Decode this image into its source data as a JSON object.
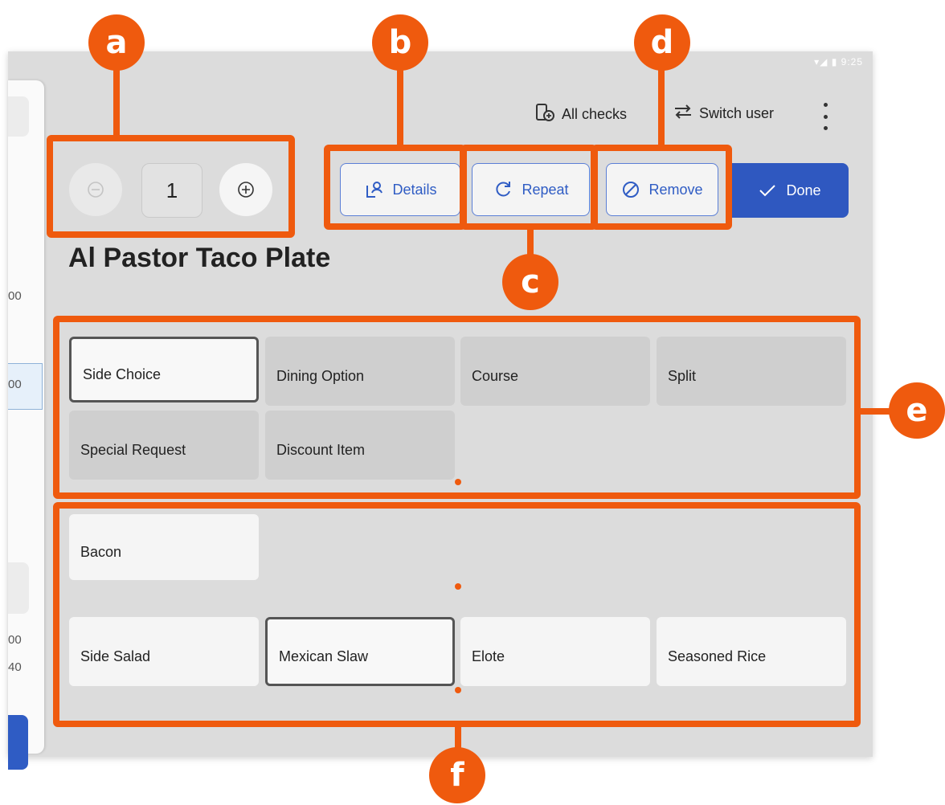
{
  "status_bar": {
    "time": "9:25"
  },
  "header": {
    "all_checks_label": "All checks",
    "switch_user_label": "Switch user"
  },
  "left_panel": {
    "row1": "00",
    "row2": "00",
    "row3": "00",
    "row4": "40"
  },
  "quantity": {
    "value": "1"
  },
  "actions": {
    "details_label": "Details",
    "repeat_label": "Repeat",
    "remove_label": "Remove",
    "done_label": "Done"
  },
  "item": {
    "title": "Al Pastor Taco Plate"
  },
  "modifier_groups": [
    "Side Choice",
    "Dining Option",
    "Course",
    "Split",
    "Special Request",
    "Discount Item"
  ],
  "modifiers": {
    "row1": [
      "Bacon"
    ],
    "row2": [
      "Side Salad",
      "Mexican Slaw",
      "Elote",
      "Seasoned Rice"
    ]
  },
  "annotations": {
    "a": "a",
    "b": "b",
    "c": "c",
    "d": "d",
    "e": "e",
    "f": "f"
  },
  "colors": {
    "accent": "#2f58c0",
    "annotation": "#ef5a0e",
    "background": "#dcdcdc"
  },
  "icons": [
    "minus-circle-icon",
    "plus-circle-icon",
    "details-icon",
    "repeat-icon",
    "remove-icon",
    "check-icon",
    "all-checks-icon",
    "switch-user-icon",
    "more-vert-icon"
  ]
}
